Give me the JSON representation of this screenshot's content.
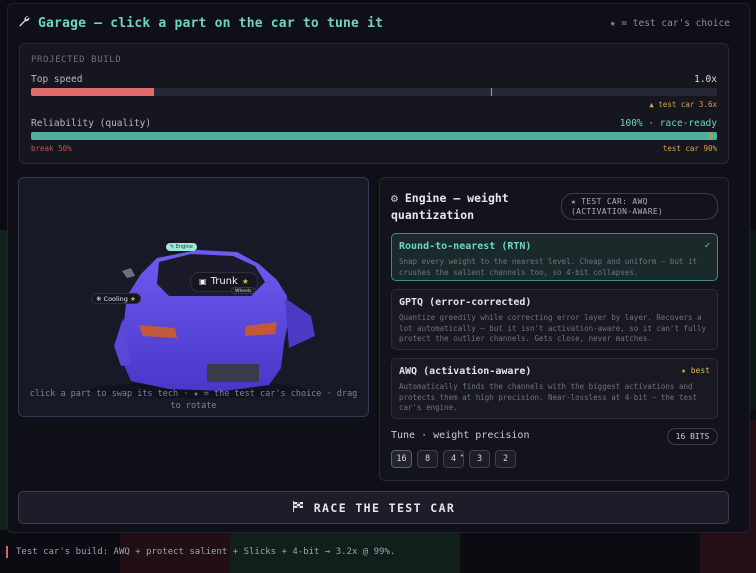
{
  "header": {
    "title": "Garage — click a part on the car to tune it",
    "legend": "★ = test car's choice"
  },
  "build": {
    "heading": "PROJECTED BUILD",
    "speed": {
      "label": "Top speed",
      "value": "1.0x",
      "fill": 0.18,
      "marker": 0.67,
      "note": "▲ test car 3.6x"
    },
    "reliability": {
      "label": "Reliability (quality)",
      "value": "100% · race-ready",
      "fill": 1.0,
      "marker": 0.99,
      "break_label": "break 50%",
      "note": "test car 90%"
    }
  },
  "viewport": {
    "tags": {
      "engine": "✎ Engine",
      "trunk": "Trunk",
      "cooling": "Cooling",
      "wheels": "Wheels"
    },
    "hint": "click a part to swap its tech · ★ = the test car's choice · drag to rotate"
  },
  "panel": {
    "title": "Engine — weight quantization",
    "badge": "★ TEST CAR: AWQ (ACTIVATION-AWARE)",
    "options": [
      {
        "name": "Round-to-nearest (RTN)",
        "desc": "Snap every weight to the nearest level. Cheap and uniform — but it crushes the salient channels too, so 4-bit collapses.",
        "selected": true,
        "mark": "✓"
      },
      {
        "name": "GPTQ (error-corrected)",
        "desc": "Quantize greedily while correcting error layer by layer. Recovers a lot automatically — but it isn't activation-aware, so it can't fully protect the outlier channels. Gets close, never matches.",
        "selected": false,
        "mark": ""
      },
      {
        "name": "AWQ (activation-aware)",
        "desc": "Automatically finds the channels with the biggest activations and protects them at high precision. Near-lossless at 4-bit — the test car's engine.",
        "selected": false,
        "mark": "★ best"
      }
    ],
    "tune_label": "Tune · weight precision",
    "bits_badge": "16 BITS",
    "precisions": [
      "16",
      "8",
      "4",
      "3",
      "2"
    ]
  },
  "race_button": "RACE THE TEST CAR",
  "footer": "Test car's build: AWQ + protect salient + Slicks + 4-bit → 3.2x @ 99%.",
  "colors": {
    "accent": "#6fd4c4",
    "speed_fill": "#e06b6b",
    "reliability_fill": "#4fae9d",
    "gold": "#e0b445",
    "car": "#6a57e8"
  }
}
